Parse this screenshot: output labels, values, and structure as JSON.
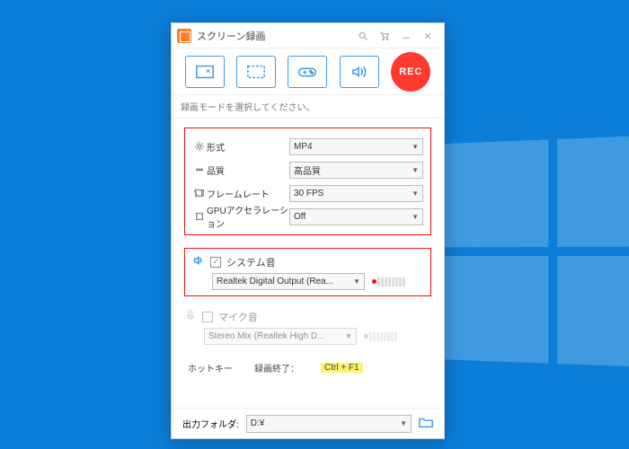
{
  "window": {
    "title": "スクリーン録画",
    "rec_label": "REC",
    "hint": "録画モードを選択してください。"
  },
  "settings": {
    "format": {
      "label": "形式",
      "value": "MP4"
    },
    "quality": {
      "label": "品質",
      "value": "高品質"
    },
    "fps": {
      "label": "フレームレート",
      "value": "30 FPS"
    },
    "gpu": {
      "label": "GPUアクセラレーション",
      "value": "Off"
    }
  },
  "audio": {
    "system": {
      "label": "システム音",
      "checked": true,
      "device": "Realtek Digital Output (Rea..."
    },
    "mic": {
      "label": "マイク音",
      "checked": false,
      "device": "Stereo Mix (Realtek High D..."
    }
  },
  "hotkey": {
    "section": "ホットキー",
    "label": "録画終了：",
    "value": "Ctrl + F1"
  },
  "output": {
    "label": "出力フォルダ:",
    "path": "D:¥"
  }
}
